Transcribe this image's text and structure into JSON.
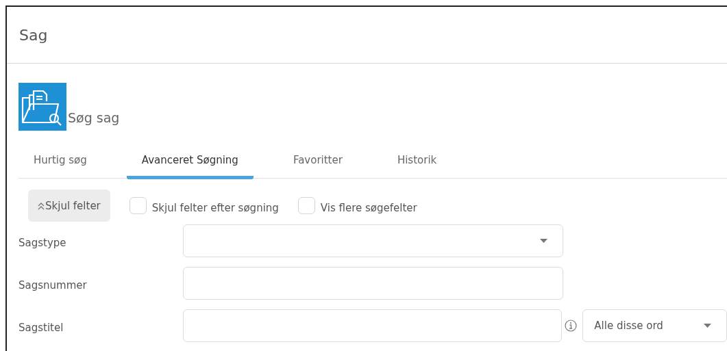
{
  "header": {
    "title": "Sag"
  },
  "section": {
    "title": "Søg sag"
  },
  "tabs": [
    {
      "label": "Hurtig søg",
      "selected": false
    },
    {
      "label": "Avanceret Søgning",
      "selected": true
    },
    {
      "label": "Favoritter",
      "selected": false
    },
    {
      "label": "Historik",
      "selected": false
    }
  ],
  "toggle_button": {
    "label": "Skjul felter"
  },
  "options": [
    {
      "label": "Skjul felter efter søgning",
      "checked": false
    },
    {
      "label": "Vis flere søgefelter",
      "checked": false
    }
  ],
  "fields": [
    {
      "label": "Sagstype",
      "kind": "select"
    },
    {
      "label": "Sagsnummer",
      "kind": "text"
    },
    {
      "label": "Sagstitel",
      "kind": "text_with_mode",
      "mode": "Alle disse ord"
    }
  ]
}
